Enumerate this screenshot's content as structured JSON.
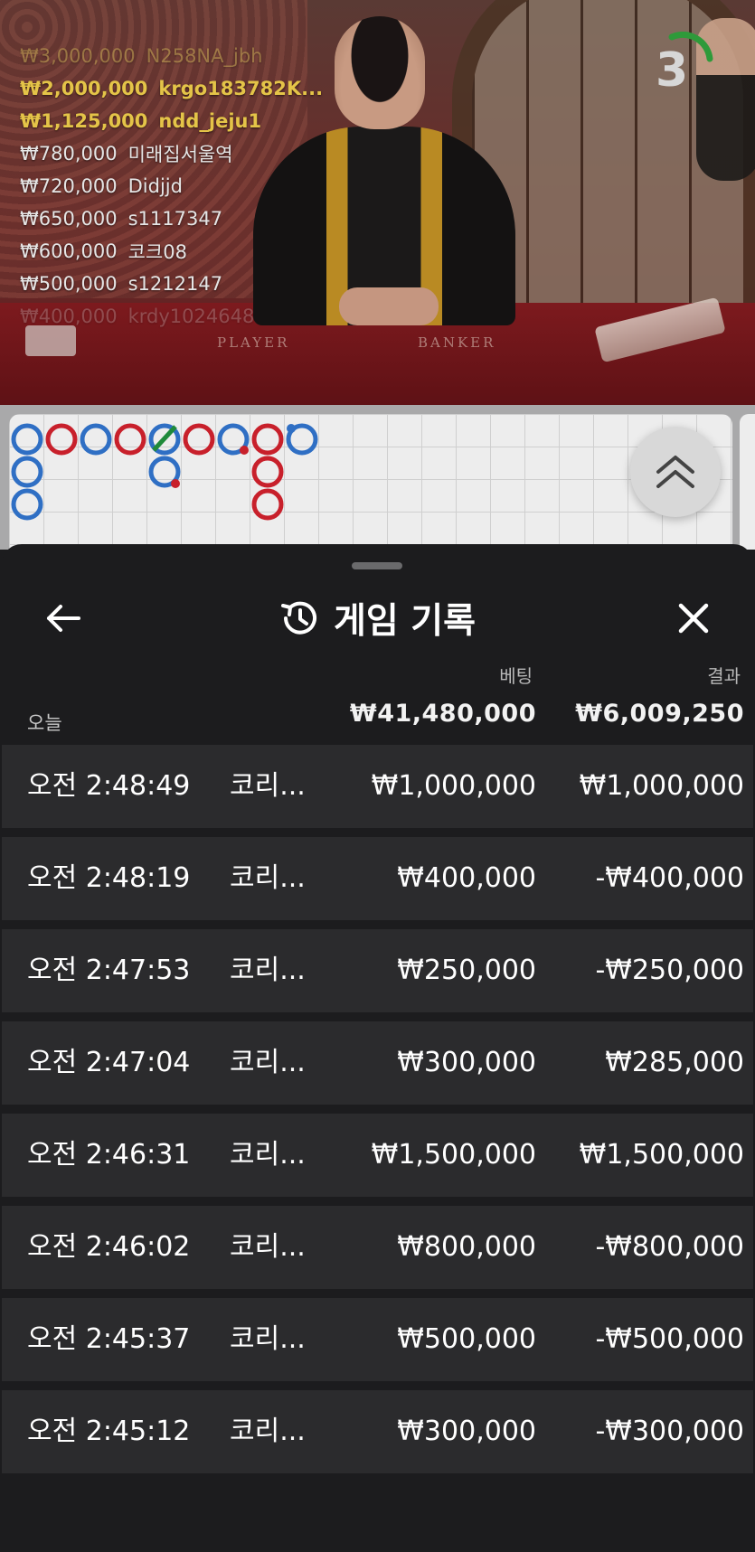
{
  "video": {
    "bets": [
      {
        "amount": "₩3,000,000",
        "user": "N258NA_jbh",
        "style": "gold-faded"
      },
      {
        "amount": "₩2,000,000",
        "user": "krgo183782K...",
        "style": "gold"
      },
      {
        "amount": "₩1,125,000",
        "user": "ndd_jeju1",
        "style": "gold"
      },
      {
        "amount": "₩780,000",
        "user": "미래집서울역",
        "style": "white-row"
      },
      {
        "amount": "₩720,000",
        "user": "Didjjd",
        "style": "white-row"
      },
      {
        "amount": "₩650,000",
        "user": "s1117347",
        "style": "white-row"
      },
      {
        "amount": "₩600,000",
        "user": "코크08",
        "style": "white-row"
      },
      {
        "amount": "₩500,000",
        "user": "s1212147",
        "style": "white-row"
      },
      {
        "amount": "₩400,000",
        "user": "krdy1024648",
        "style": "white-faded"
      }
    ],
    "table_labels": {
      "player": "PLAYER",
      "banker": "BANKER"
    },
    "countdown": "3",
    "countdown_color": "#2e9a3a"
  },
  "road_map": {
    "colors": {
      "player": "#2f6fc4",
      "banker": "#c8202b",
      "tie": "#1f8a3a"
    },
    "scroll_up_icon": "double-chevron-up-icon"
  },
  "history": {
    "title": "게임 기록",
    "title_icon": "history-icon",
    "back_icon": "arrow-left-icon",
    "close_icon": "close-icon",
    "columns": {
      "bet": "베팅",
      "result": "결과"
    },
    "summary": {
      "label": "오늘",
      "bet_total": "₩41,480,000",
      "result_total": "₩6,009,250"
    },
    "rows": [
      {
        "time": "오전 2:48:49",
        "game": "코리...",
        "bet": "₩1,000,000",
        "result": "₩1,000,000"
      },
      {
        "time": "오전 2:48:19",
        "game": "코리...",
        "bet": "₩400,000",
        "result": "-₩400,000"
      },
      {
        "time": "오전 2:47:53",
        "game": "코리...",
        "bet": "₩250,000",
        "result": "-₩250,000"
      },
      {
        "time": "오전 2:47:04",
        "game": "코리...",
        "bet": "₩300,000",
        "result": "₩285,000"
      },
      {
        "time": "오전 2:46:31",
        "game": "코리...",
        "bet": "₩1,500,000",
        "result": "₩1,500,000"
      },
      {
        "time": "오전 2:46:02",
        "game": "코리...",
        "bet": "₩800,000",
        "result": "-₩800,000"
      },
      {
        "time": "오전 2:45:37",
        "game": "코리...",
        "bet": "₩500,000",
        "result": "-₩500,000"
      },
      {
        "time": "오전 2:45:12",
        "game": "코리...",
        "bet": "₩300,000",
        "result": "-₩300,000"
      }
    ]
  }
}
